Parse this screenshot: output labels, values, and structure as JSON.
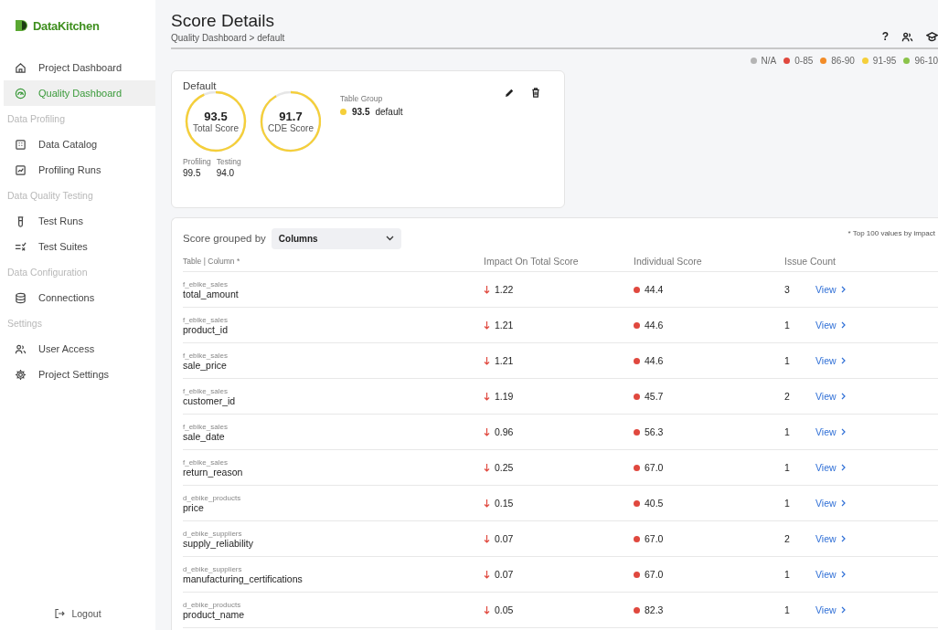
{
  "brand": "DataKitchen",
  "sidebar": [
    {
      "kind": "item",
      "label": "Project Dashboard",
      "selected": false
    },
    {
      "kind": "item",
      "label": "Quality Dashboard",
      "selected": true
    },
    {
      "kind": "section",
      "label": "Data Profiling"
    },
    {
      "kind": "item",
      "label": "Data Catalog",
      "selected": false
    },
    {
      "kind": "item",
      "label": "Profiling Runs",
      "selected": false
    },
    {
      "kind": "section",
      "label": "Data Quality Testing"
    },
    {
      "kind": "item",
      "label": "Test Runs",
      "selected": false
    },
    {
      "kind": "item",
      "label": "Test Suites",
      "selected": false
    },
    {
      "kind": "section",
      "label": "Data Configuration"
    },
    {
      "kind": "item",
      "label": "Connections",
      "selected": false
    },
    {
      "kind": "section",
      "label": "Settings"
    },
    {
      "kind": "item",
      "label": "User Access",
      "selected": false
    },
    {
      "kind": "item",
      "label": "Project Settings",
      "selected": false
    }
  ],
  "logout": "Logout",
  "title": "Score Details",
  "breadcrumb": "Quality Dashboard > default",
  "help": "?",
  "legend": [
    {
      "label": "N/A",
      "color": "#b4b4b4"
    },
    {
      "label": "0-85",
      "color": "#e0483e"
    },
    {
      "label": "86-90",
      "color": "#f28c28"
    },
    {
      "label": "91-95",
      "color": "#f5cf3a"
    },
    {
      "label": "96-10",
      "color": "#8bc34a"
    }
  ],
  "scorecard": {
    "name": "Default",
    "rings": [
      {
        "value": "93.5",
        "label": "Total Score",
        "level": 0.935,
        "color": "#f5cf3a"
      },
      {
        "value": "91.7",
        "label": "CDE Score",
        "level": 0.917,
        "color": "#f5cf3a"
      }
    ],
    "sub_scores": [
      {
        "label": "Profiling",
        "value": "99.5"
      },
      {
        "label": "Testing",
        "value": "94.0"
      }
    ],
    "group_heading": "Table Group",
    "groups": [
      {
        "score": "93.5",
        "name": "default",
        "color": "#f5cf3a"
      }
    ]
  },
  "grouped_label": "Score grouped by",
  "grouped_value": "Columns",
  "footnote": "* Top 100 values by impact",
  "columns": [
    "Table | Column *",
    "Impact On Total Score",
    "Individual Score",
    "Issue Count"
  ],
  "rows": [
    {
      "table": "f_ebike_sales",
      "column": "total_amount",
      "impact": "1.22",
      "score": "44.4",
      "color": "#e0483e",
      "issues": "3",
      "link": "View"
    },
    {
      "table": "f_ebike_sales",
      "column": "product_id",
      "impact": "1.21",
      "score": "44.6",
      "color": "#e0483e",
      "issues": "1",
      "link": "View"
    },
    {
      "table": "f_ebike_sales",
      "column": "sale_price",
      "impact": "1.21",
      "score": "44.6",
      "color": "#e0483e",
      "issues": "1",
      "link": "View"
    },
    {
      "table": "f_ebike_sales",
      "column": "customer_id",
      "impact": "1.19",
      "score": "45.7",
      "color": "#e0483e",
      "issues": "2",
      "link": "View"
    },
    {
      "table": "f_ebike_sales",
      "column": "sale_date",
      "impact": "0.96",
      "score": "56.3",
      "color": "#e0483e",
      "issues": "1",
      "link": "View"
    },
    {
      "table": "f_ebike_sales",
      "column": "return_reason",
      "impact": "0.25",
      "score": "67.0",
      "color": "#e0483e",
      "issues": "1",
      "link": "View"
    },
    {
      "table": "d_ebike_products",
      "column": "price",
      "impact": "0.15",
      "score": "40.5",
      "color": "#e0483e",
      "issues": "1",
      "link": "View"
    },
    {
      "table": "d_ebike_suppliers",
      "column": "supply_reliability",
      "impact": "0.07",
      "score": "67.0",
      "color": "#e0483e",
      "issues": "2",
      "link": "View"
    },
    {
      "table": "d_ebike_suppliers",
      "column": "manufacturing_certifications",
      "impact": "0.07",
      "score": "67.0",
      "color": "#e0483e",
      "issues": "1",
      "link": "View"
    },
    {
      "table": "d_ebike_products",
      "column": "product_name",
      "impact": "0.05",
      "score": "82.3",
      "color": "#e0483e",
      "issues": "1",
      "link": "View"
    }
  ]
}
